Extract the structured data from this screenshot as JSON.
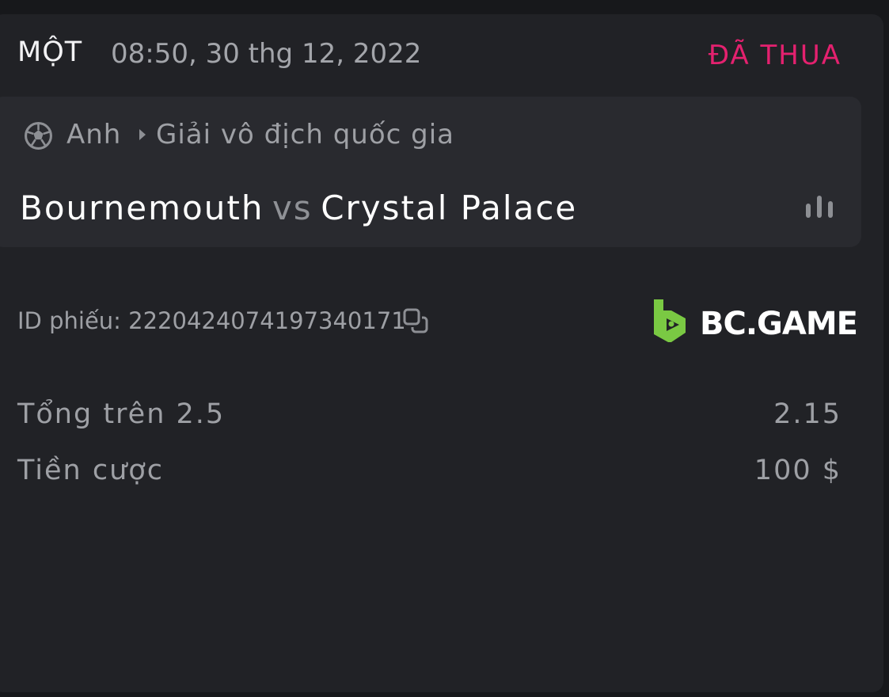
{
  "header": {
    "bet_type": "MỘT",
    "datetime": "08:50, 30 thg 12, 2022",
    "status": "ĐÃ THUA"
  },
  "match": {
    "sport_icon": "soccer-ball-icon",
    "country": "Anh",
    "league": "Giải vô địch quốc gia",
    "home_team": "Bournemouth",
    "vs": "vs",
    "away_team": "Crystal Palace",
    "stats_icon": "bar-chart-icon"
  },
  "ticket": {
    "label": "ID phiếu: 2220424074197340171",
    "copy_icon": "copy-icon"
  },
  "brand": {
    "name": "BC.GAME",
    "logo_color": "#7ac943"
  },
  "bet": {
    "selection_label": "Tổng trên 2.5",
    "odds": "2.15",
    "stake_label": "Tiền cược",
    "stake_value": "100 $"
  },
  "colors": {
    "status_lost": "#e4216f",
    "card_bg": "#212226",
    "match_bg": "#292a2f"
  }
}
